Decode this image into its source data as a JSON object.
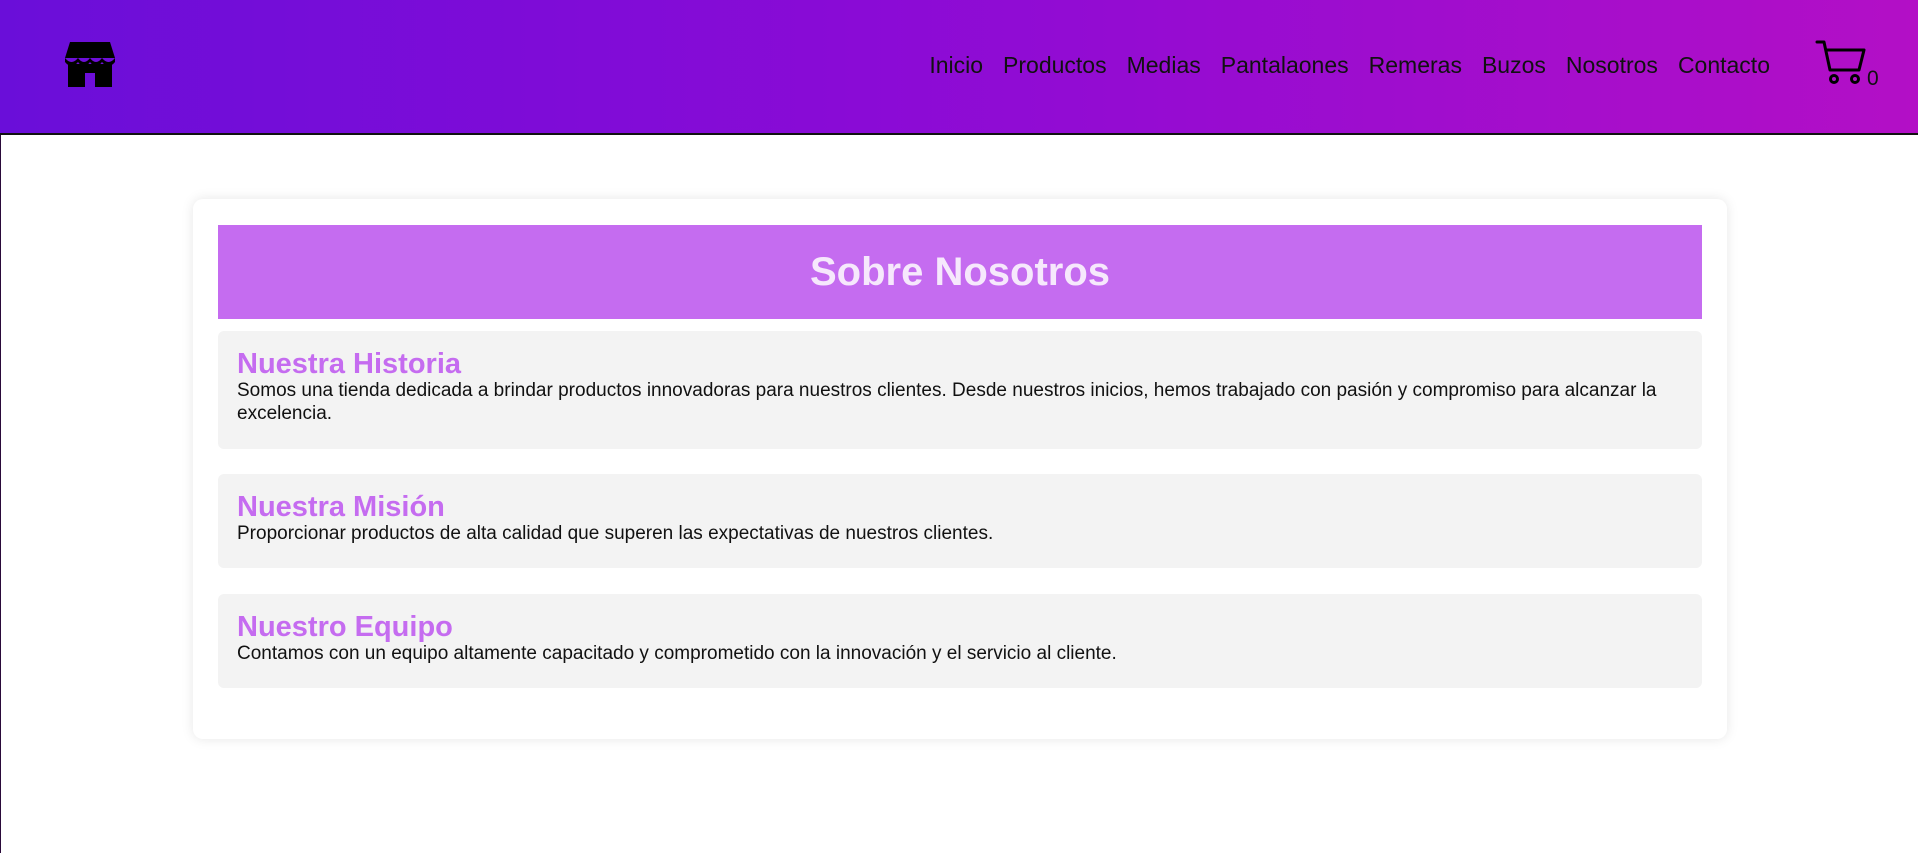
{
  "header": {
    "logo_icon": "store-icon",
    "nav": [
      {
        "label": "Inicio"
      },
      {
        "label": "Productos"
      },
      {
        "label": "Medias"
      },
      {
        "label": "Pantalaones"
      },
      {
        "label": "Remeras"
      },
      {
        "label": "Buzos"
      },
      {
        "label": "Nosotros"
      },
      {
        "label": "Contacto"
      }
    ],
    "cart": {
      "icon": "cart-icon",
      "count": "0"
    },
    "gradient_colors": [
      "#6a0ed9",
      "#b30fc6"
    ]
  },
  "main": {
    "title": "Sobre Nosotros",
    "sections": [
      {
        "heading": "Nuestra Historia",
        "text": "Somos una tienda dedicada a brindar productos innovadoras para nuestros clientes. Desde nuestros inicios, hemos trabajado con pasión y compromiso para alcanzar la excelencia."
      },
      {
        "heading": "Nuestra Misión",
        "text": "Proporcionar productos de alta calidad que superen las expectativas de nuestros clientes."
      },
      {
        "heading": "Nuestro Equipo",
        "text": "Contamos con un equipo altamente capacitado y comprometido con la innovación y el servicio al cliente."
      }
    ],
    "accent_color": "#c56cf0"
  }
}
